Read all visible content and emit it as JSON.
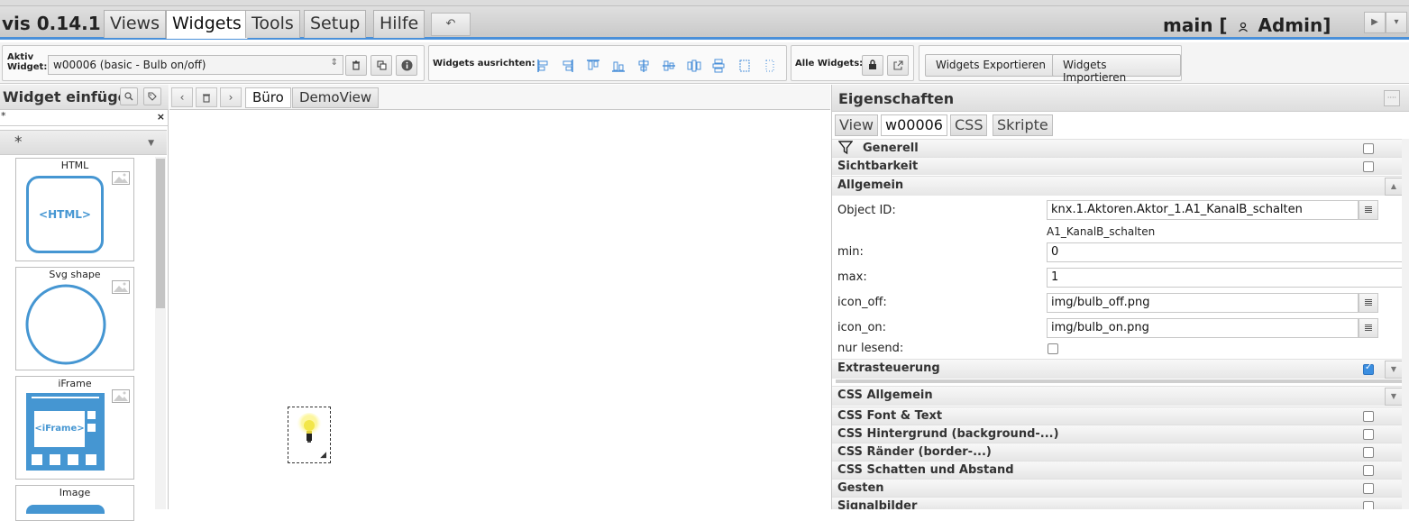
{
  "app": {
    "title": "vis 0.14.1",
    "menu": [
      "Views",
      "Widgets",
      "Tools",
      "Setup",
      "Hilfe"
    ],
    "active_menu": "Widgets",
    "undo_symbol": "↶",
    "project_prefix": "main [",
    "user_icon": "user-icon",
    "user_name": "Admin]",
    "corner_buttons": [
      "▶",
      "▾"
    ]
  },
  "toolbar": {
    "active_widget_label": "Aktiv Widget:",
    "active_widget_value": "w00006 (basic - Bulb on/off)",
    "select_arrows": "⇕",
    "align_label": "Widgets ausrichten:",
    "all_widgets_label": "Alle Widgets:",
    "export_label": "Widgets Exportieren",
    "import_label": "Widgets Importieren",
    "icons": {
      "delete": "trash-icon",
      "copy": "copy-icon",
      "info": "info-icon",
      "lock": "lock-icon",
      "popout": "external-link-icon"
    }
  },
  "left_panel": {
    "title": "Widget einfügen",
    "filter_value": "*",
    "filter_clear": "×",
    "set_value": "*",
    "set_caret": "▼",
    "widgets": [
      {
        "name": "HTML",
        "preview_text": "<HTML>"
      },
      {
        "name": "Svg shape",
        "preview_text": ""
      },
      {
        "name": "iFrame",
        "preview_text": "<iFrame>"
      },
      {
        "name": "Image",
        "preview_text": ""
      }
    ]
  },
  "views": {
    "nav_prev": "‹",
    "nav_delete": "trash-icon",
    "nav_next": "›",
    "tabs": [
      "Büro",
      "DemoView"
    ],
    "active_tab": "Büro"
  },
  "properties": {
    "title": "Eigenschaften",
    "tabs": [
      "View",
      "w00006",
      "CSS",
      "Skripte"
    ],
    "active_tab": "w00006",
    "groups": {
      "generell": "Generell",
      "sichtbarkeit": "Sichtbarkeit",
      "allgemein": "Allgemein",
      "extrasteuerung": "Extrasteuerung",
      "css_allgemein": "CSS Allgemein",
      "css_font": "CSS Font & Text",
      "css_hintergrund": "CSS Hintergrund (background-...)",
      "css_raender": "CSS Ränder (border-...)",
      "css_schatten": "CSS Schatten und Abstand",
      "gesten": "Gesten",
      "signalbilder": "Signalbilder"
    },
    "fields": {
      "object_id": {
        "label": "Object ID:",
        "value": "knx.1.Aktoren.Aktor_1.A1_KanalB_schalten",
        "hint": "A1_KanalB_schalten"
      },
      "min": {
        "label": "min:",
        "value": "0"
      },
      "max": {
        "label": "max:",
        "value": "1"
      },
      "icon_off": {
        "label": "icon_off:",
        "value": "img/bulb_off.png"
      },
      "icon_on": {
        "label": "icon_on:",
        "value": "img/bulb_on.png"
      },
      "nur_lesend": {
        "label": "nur lesend:",
        "checked": false
      }
    },
    "extrasteuerung_checked": true
  },
  "colors": {
    "accent": "#4a90d9",
    "widget_preview": "#4596d2",
    "checkbox_checked": "#3b8ee0"
  }
}
